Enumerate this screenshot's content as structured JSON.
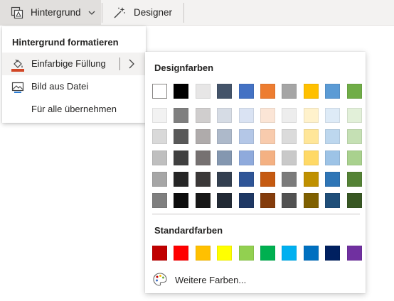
{
  "ribbon": {
    "background_button": {
      "label": "Hintergrund",
      "icon": "format-background-icon",
      "dropdown_icon": "chevron-down-icon"
    },
    "designer_button": {
      "label": "Designer",
      "icon": "designer-wand-icon"
    }
  },
  "menu": {
    "heading": "Hintergrund formatieren",
    "items": [
      {
        "label": "Einfarbige Füllung",
        "icon": "paint-bucket-icon",
        "submenu_icon": "chevron-right-icon",
        "highlighted": true,
        "accent": "#d24726"
      },
      {
        "label": "Bild aus Datei",
        "icon": "picture-icon"
      },
      {
        "label": "Für alle übernehmen"
      }
    ]
  },
  "palette": {
    "design_colors_label": "Designfarben",
    "design_colors": [
      [
        "#FFFFFF",
        "#000000",
        "#E7E6E6",
        "#44546A",
        "#4472C4",
        "#ED7D31",
        "#A5A5A5",
        "#FFC000",
        "#5B9BD5",
        "#70AD47"
      ],
      [
        "#F2F2F2",
        "#7F7F7F",
        "#D0CECE",
        "#D6DCE5",
        "#DAE3F3",
        "#FBE5D6",
        "#EDEDED",
        "#FFF2CC",
        "#DEEBF7",
        "#E2F0D9"
      ],
      [
        "#D9D9D9",
        "#595959",
        "#AFABAB",
        "#ADB9CA",
        "#B4C7E7",
        "#F8CBAD",
        "#DBDBDB",
        "#FFE699",
        "#BDD7EE",
        "#C5E0B4"
      ],
      [
        "#BFBFBF",
        "#404040",
        "#767171",
        "#8497B0",
        "#8FAADC",
        "#F4B183",
        "#C9C9C9",
        "#FFD966",
        "#9DC3E6",
        "#A9D18E"
      ],
      [
        "#A6A6A6",
        "#262626",
        "#3B3838",
        "#333F50",
        "#2F5597",
        "#C55A11",
        "#7B7B7B",
        "#BF9000",
        "#2E75B6",
        "#548235"
      ],
      [
        "#7F7F7F",
        "#0D0D0D",
        "#171717",
        "#222A35",
        "#1F3864",
        "#843C0C",
        "#525252",
        "#7F6000",
        "#1F4E79",
        "#385723"
      ]
    ],
    "standard_colors_label": "Standardfarben",
    "standard_colors": [
      "#C00000",
      "#FF0000",
      "#FFC000",
      "#FFFF00",
      "#92D050",
      "#00B050",
      "#00B0F0",
      "#0070C0",
      "#002060",
      "#7030A0"
    ],
    "more_colors": {
      "label": "Weitere Farben...",
      "icon": "color-palette-icon"
    }
  }
}
